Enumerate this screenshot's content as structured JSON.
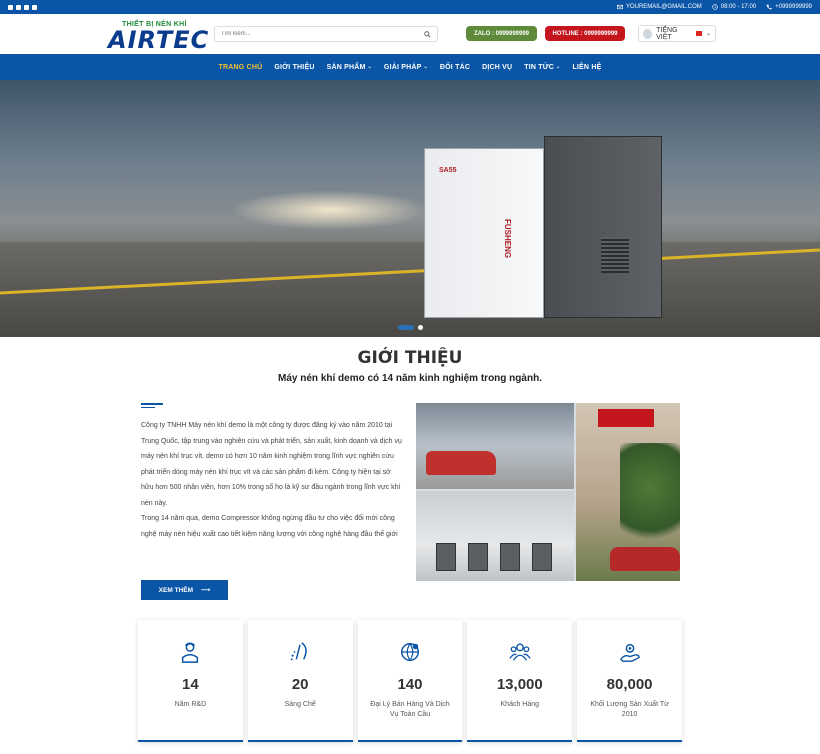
{
  "topbar": {
    "email": "YOUREMAIL@GMAIL.COM",
    "hours": "08:00 - 17:00",
    "phone": "+0999999999"
  },
  "header": {
    "logo_tagline": "THIẾT BỊ NÉN KHÍ",
    "logo_brand": "AIRTEC",
    "search_placeholder": "Tìm kiếm...",
    "zalo": "ZALO : 0999999999",
    "hotline": "HOTLINE : 0999999999",
    "language": "TIẾNG VIỆT"
  },
  "nav": {
    "items": [
      {
        "label": "TRANG CHỦ",
        "caret": ""
      },
      {
        "label": "GIỚI THIỆU",
        "caret": ""
      },
      {
        "label": "SẢN PHẨM",
        "caret": "⌄"
      },
      {
        "label": "GIẢI PHÁP",
        "caret": "⌄"
      },
      {
        "label": "ĐỐI TÁC",
        "caret": ""
      },
      {
        "label": "DỊCH VỤ",
        "caret": ""
      },
      {
        "label": "TIN TỨC",
        "caret": "⌄"
      },
      {
        "label": "LIÊN HỆ",
        "caret": ""
      }
    ]
  },
  "hero": {
    "machine_model": "SA55",
    "machine_brand": "FUSHENG"
  },
  "intro": {
    "title": "GIỚI THIỆU",
    "subtitle": "Máy nén khí demo có 14 năm kinh nghiệm trong ngành.",
    "paragraph1": "Công ty TNHH Máy nén khí demo là một công ty được đăng ký vào năm 2010 tại Trung Quốc, tập trung vào nghiên cứu và phát triển, sản xuất, kinh doanh và dịch vụ máy nén khí trục vít. demo có hơn 10 năm kinh nghiệm trong lĩnh vực nghiên cứu phát triển dòng máy nén khí trục vít và các sản phẩm đi kèm. Công ty hiện tại sở hữu hơn 500 nhân viên, hơn 10% trong số họ là kỹ sư đầu ngành trong lĩnh vực khí nén này.",
    "paragraph2": "Trong 14 năm qua, demo Compressor không ngừng đầu tư cho việc đổi mới công nghệ máy nén hiệu xuất cao tiết kiệm năng lượng với công nghệ hàng đầu thế giới",
    "button": "XEM THÊM",
    "button_arrow": "⟶"
  },
  "stats": [
    {
      "icon": "engineer-icon",
      "number": "14",
      "label": "Năm R&D"
    },
    {
      "icon": "patent-icon",
      "number": "20",
      "label": "Sáng Chế"
    },
    {
      "icon": "globe-icon",
      "number": "140",
      "label": "Đại Lý Bán Hàng Và Dịch Vụ Toàn Cầu"
    },
    {
      "icon": "customers-icon",
      "number": "13,000",
      "label": "Khách Hàng"
    },
    {
      "icon": "production-icon",
      "number": "80,000",
      "label": "Khối Lượng Sản Xuất Từ 2010"
    }
  ],
  "colors": {
    "primary": "#0a55a6",
    "nav_active": "#f4c430",
    "zalo": "#5e8a3a",
    "hotline": "#c4161c"
  }
}
